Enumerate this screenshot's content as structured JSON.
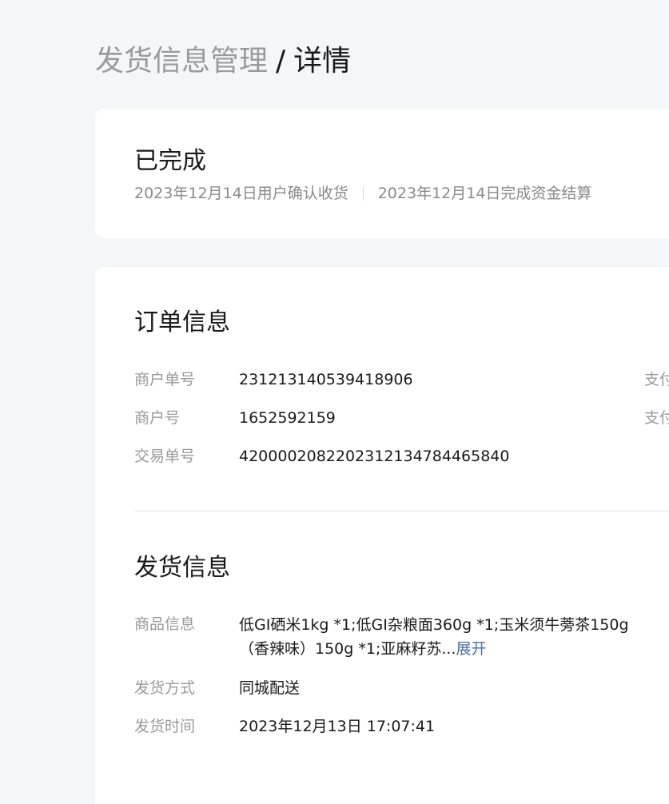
{
  "breadcrumb": {
    "parent": "发货信息管理",
    "separator": "/",
    "current": "详情"
  },
  "status": {
    "title": "已完成",
    "confirm_text": "2023年12月14日用户确认收货",
    "settle_text": "2023年12月14日完成资金结算"
  },
  "order_info": {
    "title": "订单信息",
    "rows": [
      {
        "label": "商户单号",
        "value": "231213140539418906"
      },
      {
        "label": "商户号",
        "value": "1652592159"
      },
      {
        "label": "交易单号",
        "value": "4200002082202312134784465840"
      }
    ],
    "right_labels": [
      "支付",
      "支付"
    ]
  },
  "shipping_info": {
    "title": "发货信息",
    "goods_label": "商品信息",
    "goods_line1": "低GI硒米1kg *1;低GI杂粮面360g *1;玉米须牛蒡茶150g",
    "goods_line2": "（香辣味）150g *1;亚麻籽苏...",
    "expand_label": "展开",
    "method_label": "发货方式",
    "method_value": "同城配送",
    "time_label": "发货时间",
    "time_value": "2023年12月13日 17:07:41"
  }
}
